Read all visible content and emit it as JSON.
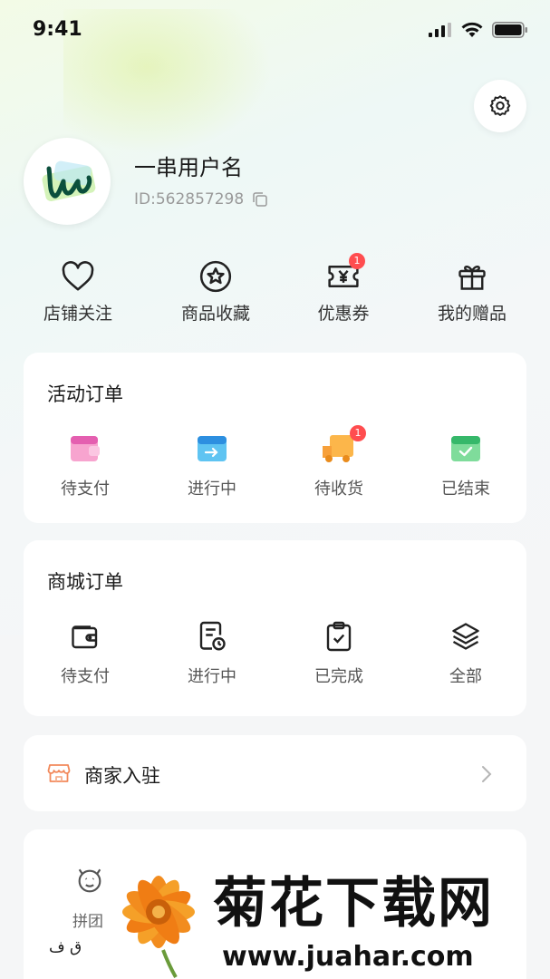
{
  "status_bar": {
    "time": "9:41"
  },
  "profile": {
    "username": "一串用户名",
    "user_id": "ID:562857298"
  },
  "quick_links": [
    {
      "label": "店铺关注",
      "icon": "heart-icon"
    },
    {
      "label": "商品收藏",
      "icon": "star-icon"
    },
    {
      "label": "优惠券",
      "icon": "coupon-icon",
      "badge": "1"
    },
    {
      "label": "我的赠品",
      "icon": "gift-icon"
    }
  ],
  "activity_orders": {
    "title": "活动订单",
    "items": [
      {
        "label": "待支付",
        "icon": "wallet-pink-icon"
      },
      {
        "label": "进行中",
        "icon": "box-blue-icon"
      },
      {
        "label": "待收货",
        "icon": "truck-orange-icon",
        "badge": "1"
      },
      {
        "label": "已结束",
        "icon": "check-green-icon"
      }
    ]
  },
  "mall_orders": {
    "title": "商城订单",
    "items": [
      {
        "label": "待支付",
        "icon": "wallet-icon"
      },
      {
        "label": "进行中",
        "icon": "document-clock-icon"
      },
      {
        "label": "已完成",
        "icon": "clipboard-check-icon"
      },
      {
        "label": "全部",
        "icon": "layers-icon"
      }
    ]
  },
  "merchant": {
    "label": "商家入驻",
    "icon": "shop-icon"
  },
  "bottom": {
    "group_label": "拼团",
    "partial_text": "ق ف"
  },
  "watermark": {
    "title": "菊花下载网",
    "url": "www.juahar.com"
  },
  "colors": {
    "badge": "#ff4d4f",
    "accent_green": "#2bb673"
  }
}
